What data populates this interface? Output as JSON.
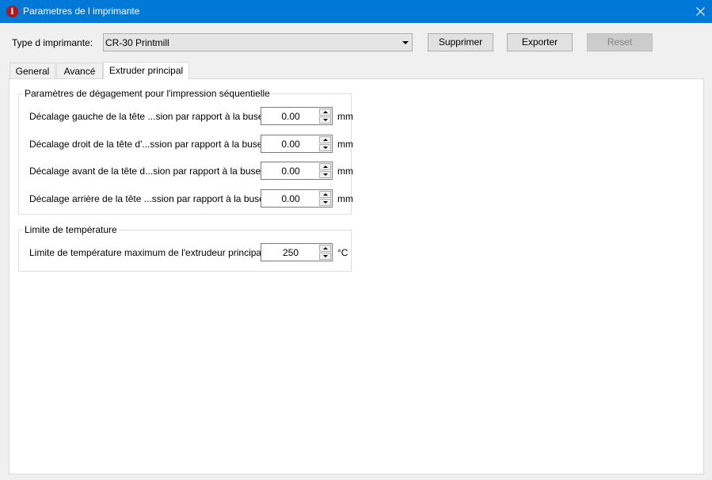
{
  "window": {
    "title": "Parametres de l imprimante",
    "icon": "info-icon"
  },
  "printer": {
    "type_label": "Type d imprimante:",
    "selected": "CR-30 Printmill"
  },
  "buttons": {
    "delete": "Supprimer",
    "export": "Exporter",
    "reset": "Reset"
  },
  "tabs": [
    {
      "label": "General",
      "active": false
    },
    {
      "label": "Avancé",
      "active": false
    },
    {
      "label": "Extruder principal",
      "active": true
    }
  ],
  "clearance_group": {
    "title": "Paramètres de dégagement pour l'impression séquentielle",
    "rows": [
      {
        "label": "Décalage gauche de la tête ...sion par rapport à la buse:",
        "value": "0.00",
        "unit": "mm"
      },
      {
        "label": "Décalage droit de la tête d'...ssion par rapport à la buse:",
        "value": "0.00",
        "unit": "mm"
      },
      {
        "label": "Décalage avant de la tête d...sion par rapport à la buse:",
        "value": "0.00",
        "unit": "mm"
      },
      {
        "label": "Décalage arrière de la tête ...ssion par rapport à la buse:",
        "value": "0.00",
        "unit": "mm"
      }
    ]
  },
  "temp_group": {
    "title": "Limite de température",
    "label": "Limite de température maximum de l'extrudeur principal:",
    "value": "250",
    "unit": "°C"
  },
  "colors": {
    "titlebar": "#0078d7",
    "app_icon": "#b3141c"
  }
}
